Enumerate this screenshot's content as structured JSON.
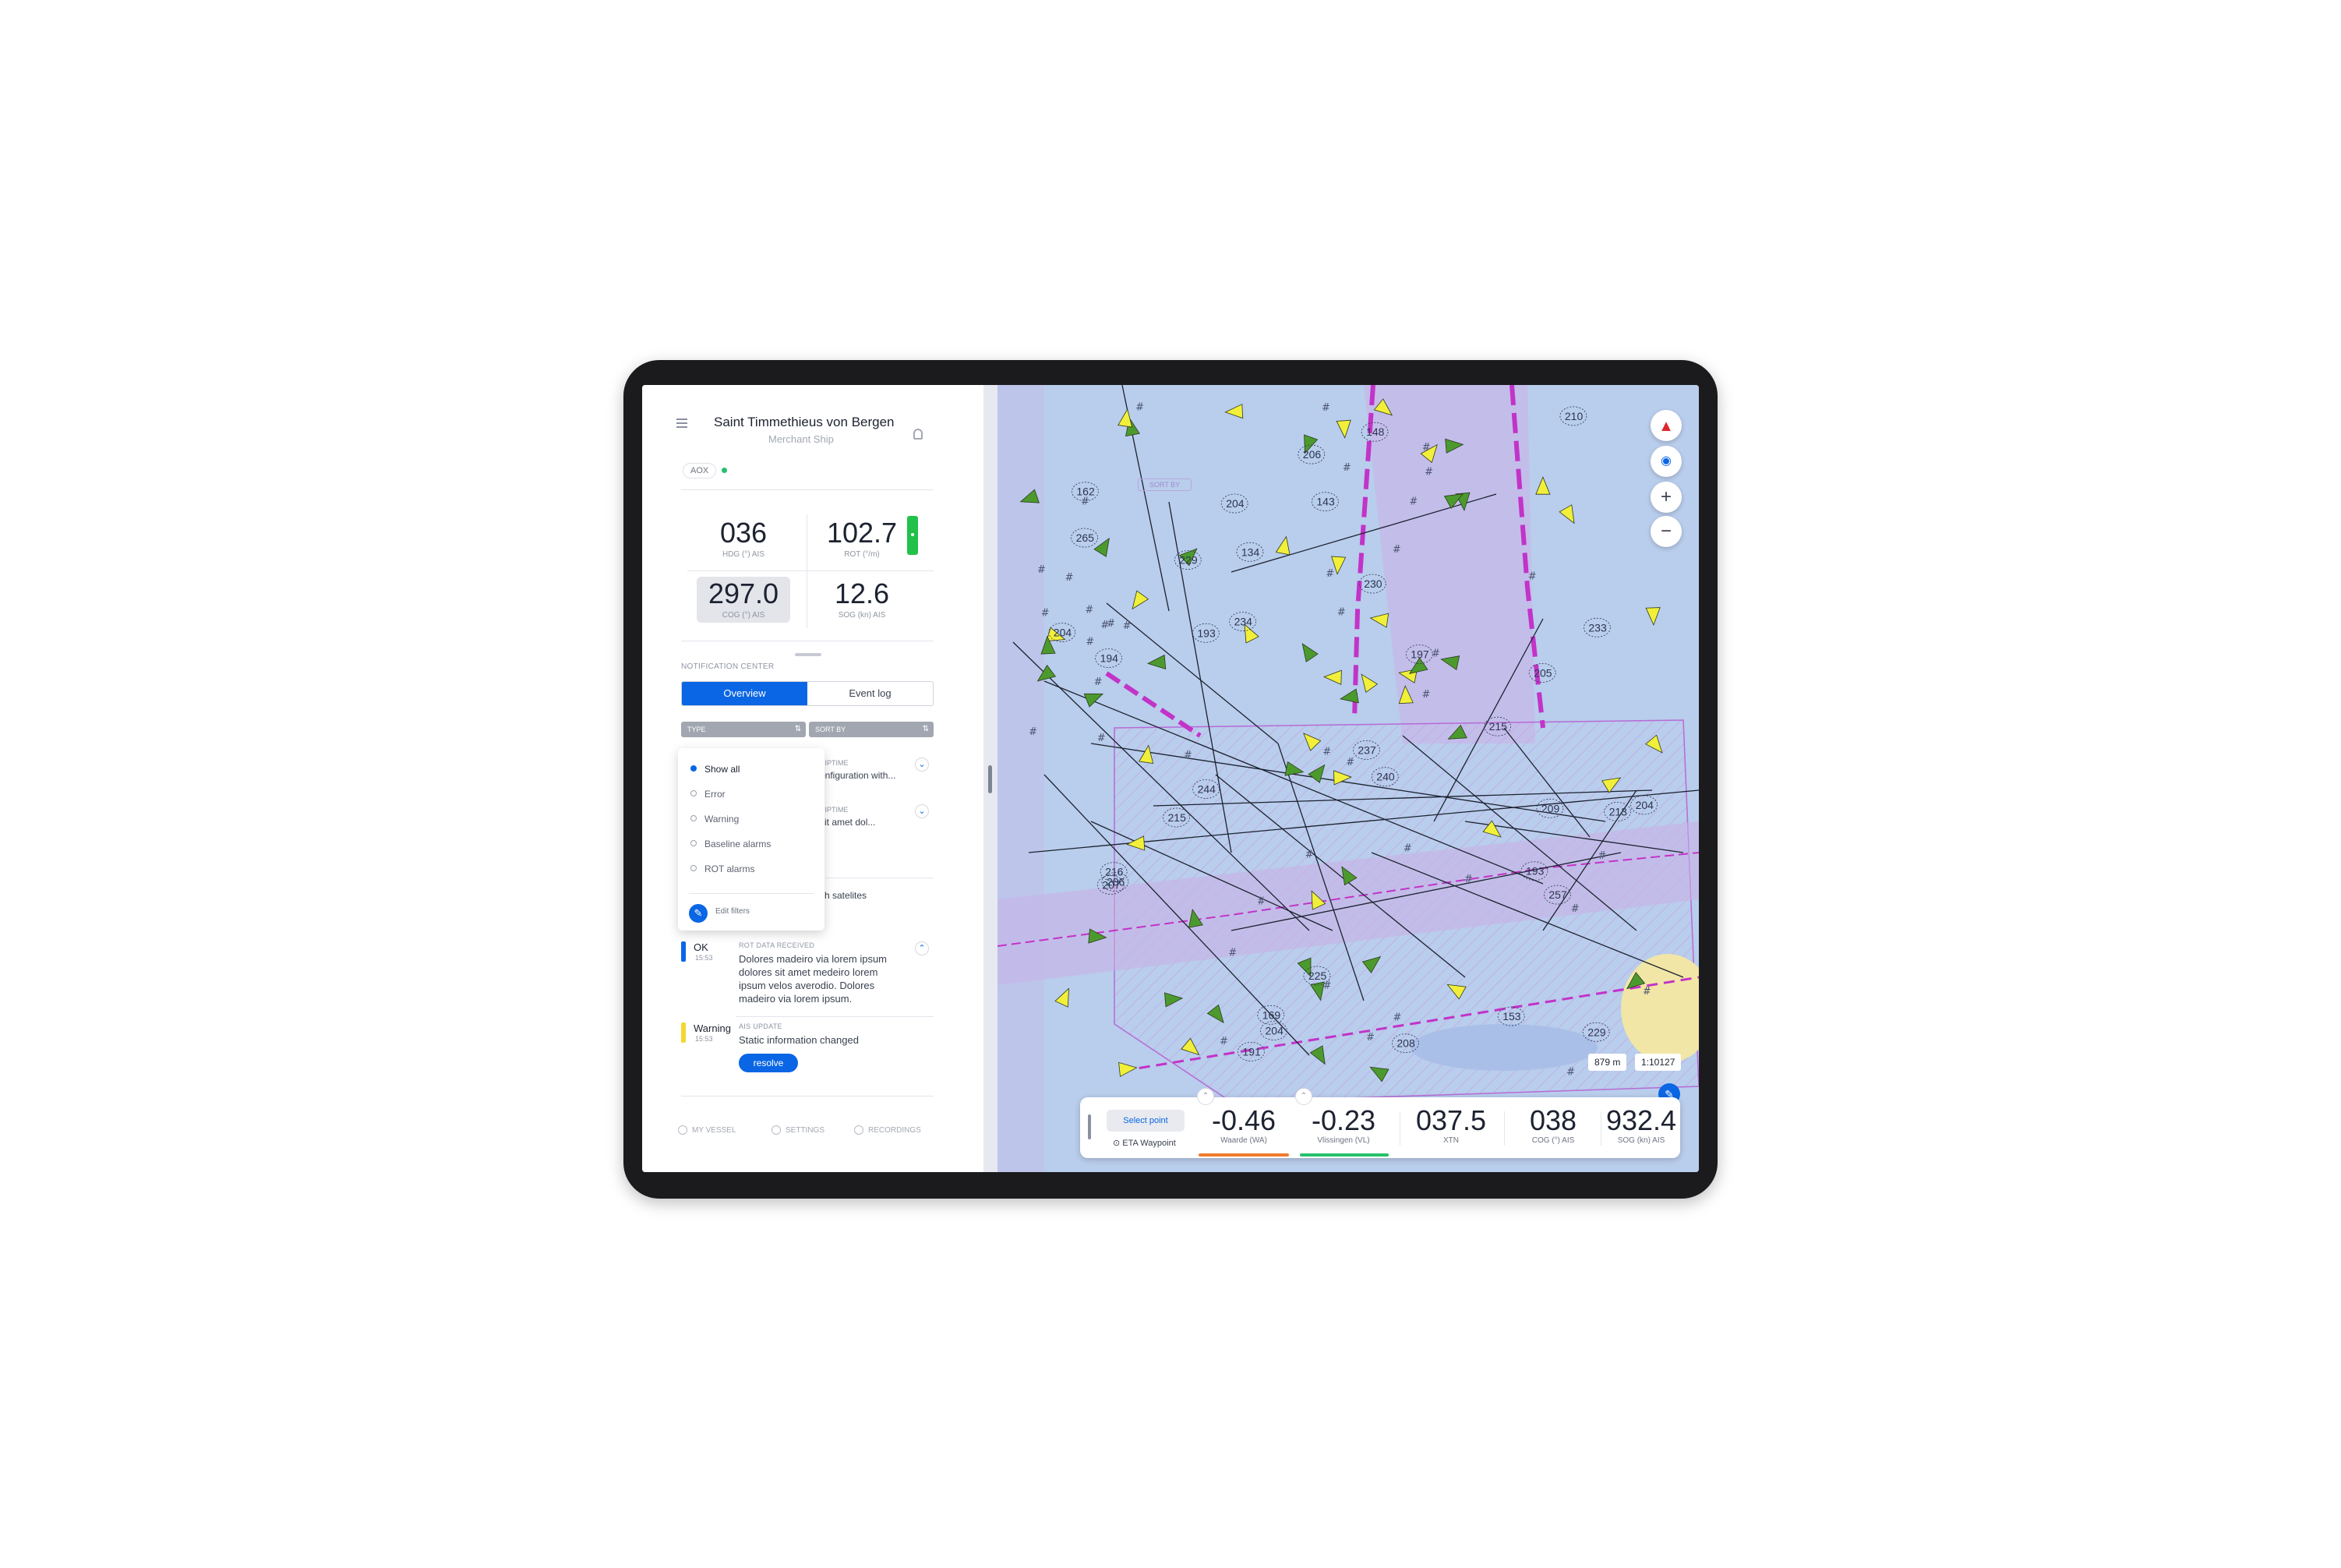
{
  "vessel": {
    "name": "Saint Timmethieus von Bergen",
    "type": "Merchant Ship",
    "source": "AOX"
  },
  "metrics": {
    "hdg": {
      "value": "036",
      "label": "HDG (°) AIS"
    },
    "rot": {
      "value": "102.7",
      "label": "ROT (°/m)"
    },
    "cog": {
      "value": "297.0",
      "label": "COG (°) AIS"
    },
    "sog": {
      "value": "12.6",
      "label": "SOG (kn) AIS"
    }
  },
  "notification_center": {
    "title": "NOTIFICATION CENTER",
    "tabs": [
      "Overview",
      "Event log"
    ],
    "filter_type": "TYPE",
    "filter_sort": "SORT BY",
    "dropdown": {
      "options": [
        "Show all",
        "Error",
        "Warning",
        "Baseline alarms",
        "ROT alarms"
      ],
      "selected": "Show all",
      "edit_label": "Edit filters"
    },
    "partial_items": [
      {
        "category": "RIPTIME",
        "text": "onfiguration with..."
      },
      {
        "category": "RIPTIME",
        "text": "sit amet dol..."
      },
      {
        "text": "ith satelites"
      }
    ],
    "items": [
      {
        "level": "OK",
        "time": "15:53",
        "category": "ROT DATA RECEIVED",
        "body": "Dolores madeiro via lorem ipsum dolores sit amet medeiro lorem ipsum velos averodio. Dolores madeiro via lorem ipsum.",
        "color": "#0a66e4"
      },
      {
        "level": "Warning",
        "time": "15:53",
        "category": "AIS UPDATE",
        "body": "Static information changed",
        "action": "resolve",
        "color": "#f3d832"
      }
    ]
  },
  "footer_nav": [
    "MY VESSEL",
    "SETTINGS",
    "RECORDINGS"
  ],
  "map": {
    "sort_ghost": "SORT BY",
    "controls": {
      "zoom_in": "+",
      "zoom_out": "−"
    },
    "scale_distance": "879 m",
    "scale_ratio": "1:10127",
    "depths": [
      "207",
      "210",
      "230",
      "134",
      "215",
      "215",
      "229",
      "204",
      "205",
      "265",
      "206",
      "208",
      "193",
      "204",
      "213",
      "193",
      "244",
      "216",
      "204",
      "234",
      "240",
      "194",
      "257",
      "237",
      "197",
      "162",
      "169",
      "153",
      "225",
      "206",
      "233",
      "229",
      "204",
      "191",
      "209",
      "148",
      "143"
    ]
  },
  "bottom_bar": {
    "select_point": "Select point",
    "eta": "ETA Waypoint",
    "values": [
      {
        "value": "-0.46",
        "label": "Waarde (WA)",
        "color": "#f07a2c"
      },
      {
        "value": "-0.23",
        "label": "Vlissingen (VL)",
        "color": "#25c16a"
      },
      {
        "value": "037.5",
        "label": "XTN"
      },
      {
        "value": "038",
        "label": "COG (°) AIS"
      },
      {
        "value": "932.4",
        "label": "SOG (kn) AIS"
      }
    ]
  },
  "colors": {
    "accent": "#0a66e4",
    "map_water": "#b9cdec",
    "route": "#c233c8",
    "ok": "#25c16a",
    "warning": "#f3d832"
  }
}
